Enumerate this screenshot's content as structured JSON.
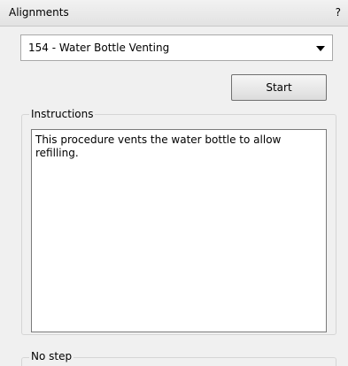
{
  "panel": {
    "title": "Alignments",
    "help_label": "?"
  },
  "procedure_select": {
    "selected": "154 - Water Bottle Venting"
  },
  "start_button": {
    "label": "Start"
  },
  "instructions": {
    "label": "Instructions",
    "text": "This procedure vents the water bottle to allow refilling."
  },
  "step": {
    "label": "No step"
  }
}
